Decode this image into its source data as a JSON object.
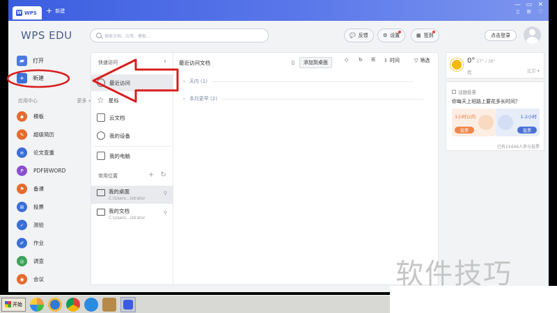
{
  "titlebar": {
    "tab_label": "WPS",
    "new_tab_label": "新建"
  },
  "header": {
    "brand": "WPS EDU",
    "search_placeholder": "搜索文档、应用、模板...",
    "feedback_label": "反馈",
    "settings_label": "设置",
    "checkin_label": "签到",
    "login_label": "点击登录"
  },
  "sidebar": {
    "open_label": "打开",
    "new_label": "新建",
    "app_center_label": "应用中心",
    "more_label": "更多 »",
    "apps": [
      {
        "label": "模板",
        "color": "#e8692c"
      },
      {
        "label": "超级简历",
        "color": "#e8692c"
      },
      {
        "label": "论文查重",
        "color": "#3a6fd8"
      },
      {
        "label": "PDF转WORD",
        "color": "#8a4fd3"
      },
      {
        "label": "备课",
        "color": "#e8692c"
      },
      {
        "label": "投票",
        "color": "#3a6fd8"
      },
      {
        "label": "测验",
        "color": "#3a6fd8"
      },
      {
        "label": "作业",
        "color": "#3a6fd8"
      },
      {
        "label": "调查",
        "color": "#3aa35a"
      },
      {
        "label": "会议",
        "color": "#e8692c"
      }
    ]
  },
  "quick_access": {
    "title": "快速访问",
    "items": [
      {
        "label": "最近访问"
      },
      {
        "label": "星标"
      },
      {
        "label": "云文档"
      },
      {
        "label": "我的设备"
      },
      {
        "label": "我的电脑"
      }
    ],
    "common_title": "常用位置",
    "locations": [
      {
        "name": "我的桌面",
        "path": "C:\\Users...istrator"
      },
      {
        "name": "我的文档",
        "path": "C:\\Users...istrator"
      }
    ]
  },
  "recent": {
    "title": "最近访问文档",
    "add_desktop_label": "添加到桌面",
    "time_label": "时间",
    "filter_label": "筛选",
    "groups": [
      {
        "label": "天内 (1)"
      },
      {
        "label": "本月更早 (2)"
      }
    ]
  },
  "weather": {
    "temp": "0°",
    "range": "27° / 38°",
    "condition": "优",
    "city": "北京 ▾"
  },
  "vote": {
    "title": "话题投票",
    "question": "你每天上班路上要花多长时间？",
    "option_a": "1小时以内",
    "option_b": "1-2小时",
    "vote_btn": "投票",
    "count": "已有23449人参与投票"
  },
  "taskbar": {
    "start_label": "开始"
  },
  "watermark": "软件技巧",
  "colors": {
    "titlebar": "#3b5ee0",
    "annotation": "#d81e1e",
    "new_icon": "#3a6fd8"
  }
}
